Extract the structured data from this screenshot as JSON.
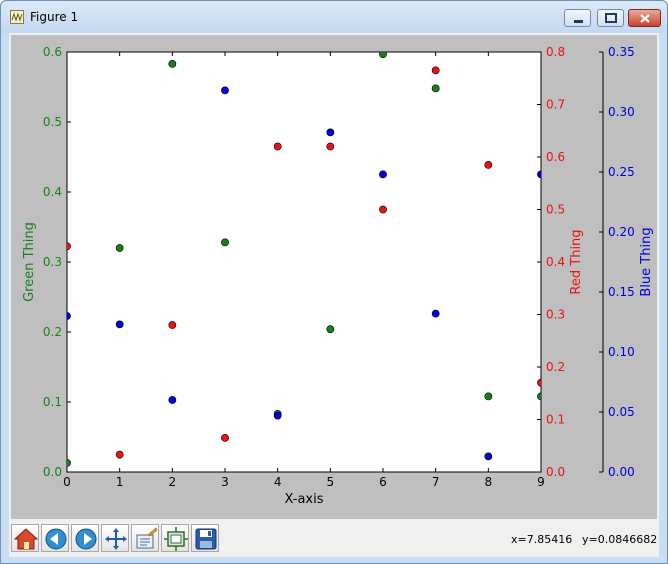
{
  "window": {
    "title": "Figure 1"
  },
  "status": {
    "x_readout": "x=7.85416",
    "y_readout": "y=0.0846682"
  },
  "toolbar": {
    "buttons": [
      "home-icon",
      "back-icon",
      "forward-icon",
      "pan-icon",
      "zoom-icon",
      "subplots-icon",
      "save-icon"
    ]
  },
  "colors": {
    "green": "#1a7f1a",
    "red": "#ee1111",
    "blue": "#0000dd",
    "figure_bg": "#bfbfbf"
  },
  "chart_data": {
    "type": "scatter",
    "xlabel": "X-axis",
    "xlim": [
      0,
      9
    ],
    "x_ticks": [
      "0",
      "1",
      "2",
      "3",
      "4",
      "5",
      "6",
      "7",
      "8",
      "9"
    ],
    "grid": false,
    "axes": [
      {
        "name": "Green Thing",
        "side": "left",
        "color": "#1a7f1a",
        "ylim": [
          0,
          0.6
        ],
        "ticks": [
          "0.0",
          "0.1",
          "0.2",
          "0.3",
          "0.4",
          "0.5",
          "0.6"
        ]
      },
      {
        "name": "Red Thing",
        "side": "right",
        "color": "#ee1111",
        "ylim": [
          0,
          0.8
        ],
        "ticks": [
          "0.0",
          "0.1",
          "0.2",
          "0.3",
          "0.4",
          "0.5",
          "0.6",
          "0.7",
          "0.8"
        ]
      },
      {
        "name": "Blue Thing",
        "side": "right-outer",
        "color": "#0000dd",
        "ylim": [
          0,
          0.35
        ],
        "ticks": [
          "0.00",
          "0.05",
          "0.10",
          "0.15",
          "0.20",
          "0.25",
          "0.30",
          "0.35"
        ]
      }
    ],
    "x": [
      0,
      1,
      2,
      3,
      4,
      5,
      6,
      7,
      8,
      9
    ],
    "series": [
      {
        "name": "Green Thing",
        "color": "#1a7f1a",
        "axis": 0,
        "values": [
          0.013,
          0.32,
          0.583,
          0.328,
          0.083,
          0.204,
          0.597,
          0.548,
          0.108,
          0.108
        ]
      },
      {
        "name": "Red Thing",
        "color": "#ee1111",
        "axis": 1,
        "values": [
          0.43,
          0.033,
          0.28,
          0.065,
          0.62,
          0.62,
          0.5,
          0.765,
          0.585,
          0.17
        ]
      },
      {
        "name": "Blue Thing",
        "color": "#0000dd",
        "axis": 2,
        "values": [
          0.13,
          0.123,
          0.06,
          0.318,
          0.047,
          0.283,
          0.248,
          0.132,
          0.013,
          0.248
        ]
      }
    ]
  }
}
